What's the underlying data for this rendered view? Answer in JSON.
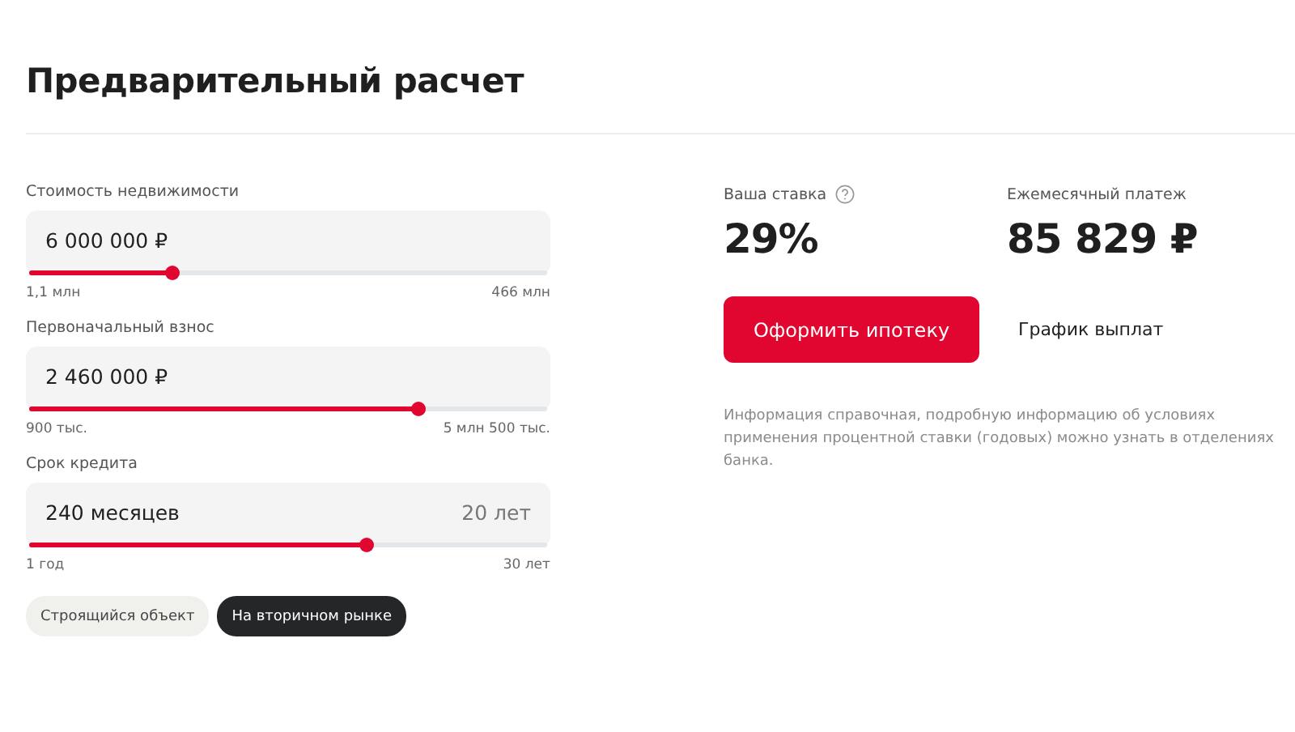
{
  "title": "Предварительный расчет",
  "sliders": [
    {
      "label": "Стоимость недвижимости",
      "value": "6 000 000 ₽",
      "min": "1,1 млн",
      "max": "466 млн",
      "level": 0.275
    },
    {
      "label": "Первоначальный взнос",
      "value": "2 460 000 ₽",
      "min": "900 тыс.",
      "max": "5 млн 500 тыс.",
      "level": 0.75
    },
    {
      "label": "Срок кредита",
      "value": "240 месяцев",
      "suffix": "20 лет",
      "min": "1 год",
      "max": "30 лет",
      "level": 0.65
    }
  ],
  "object_types": [
    {
      "label": "Строящийся объект",
      "selected": false
    },
    {
      "label": "На вторичном рынке",
      "selected": true
    }
  ],
  "rate": {
    "label": "Ваша ставка",
    "value": "29%"
  },
  "payment": {
    "label": "Ежемесячный платеж",
    "value": "85 829 ₽"
  },
  "apply_button": "Оформить ипотеку",
  "schedule_link": "График выплат",
  "note": "Информация справочная, подробную информацию об условиях применения процентной ставки (годовых) можно узнать в отделениях банка."
}
